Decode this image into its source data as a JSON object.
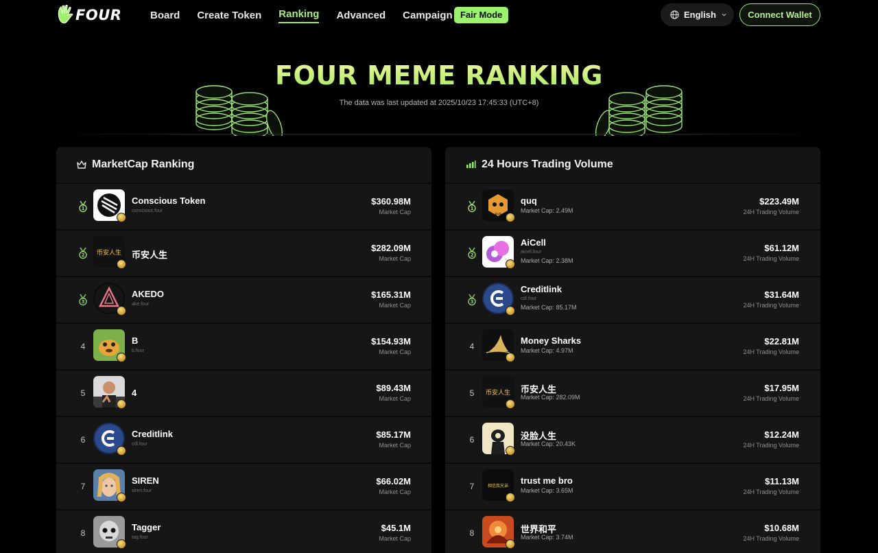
{
  "header": {
    "logo_text": "FOUR",
    "nav": [
      {
        "label": "Board",
        "active": false
      },
      {
        "label": "Create Token",
        "active": false
      },
      {
        "label": "Ranking",
        "active": true
      },
      {
        "label": "Advanced",
        "active": false
      },
      {
        "label": "Campaign",
        "active": false
      }
    ],
    "fair_mode_label": "Fair Mode",
    "language": "English",
    "connect_wallet": "Connect Wallet"
  },
  "hero": {
    "title": "FOUR MEME RANKING",
    "subtitle": "The data was last updated at 2025/10/23 17:45:33 (UTC+8)"
  },
  "marketcap_panel": {
    "title": "MarketCap Ranking",
    "icon": "crown-icon",
    "rows": [
      {
        "rank": "1",
        "medal": true,
        "name": "Conscious Token",
        "handle": "conscious.four",
        "value": "$360.98M",
        "value_label": "Market Cap",
        "avatar": "conscious"
      },
      {
        "rank": "2",
        "medal": true,
        "name": "币安人生",
        "handle": "",
        "value": "$282.09M",
        "value_label": "Market Cap",
        "avatar": "binance-life"
      },
      {
        "rank": "3",
        "medal": true,
        "name": "AKEDO",
        "handle": "ake.four",
        "value": "$165.31M",
        "value_label": "Market Cap",
        "avatar": "akedo"
      },
      {
        "rank": "4",
        "medal": false,
        "name": "B",
        "handle": "b.four",
        "value": "$154.93M",
        "value_label": "Market Cap",
        "avatar": "b"
      },
      {
        "rank": "5",
        "medal": false,
        "name": "4",
        "handle": "",
        "value": "$89.43M",
        "value_label": "Market Cap",
        "avatar": "four"
      },
      {
        "rank": "6",
        "medal": false,
        "name": "Creditlink",
        "handle": "cdl.four",
        "value": "$85.17M",
        "value_label": "Market Cap",
        "avatar": "creditlink"
      },
      {
        "rank": "7",
        "medal": false,
        "name": "SIREN",
        "handle": "siren.four",
        "value": "$66.02M",
        "value_label": "Market Cap",
        "avatar": "siren"
      },
      {
        "rank": "8",
        "medal": false,
        "name": "Tagger",
        "handle": "tag.four",
        "value": "$45.1M",
        "value_label": "Market Cap",
        "avatar": "tagger"
      }
    ]
  },
  "volume_panel": {
    "title": "24 Hours Trading Volume",
    "icon": "bar-chart-icon",
    "rows": [
      {
        "rank": "1",
        "medal": true,
        "name": "quq",
        "handle": "",
        "mcap": "Market Cap: 2.49M",
        "value": "$223.49M",
        "value_label": "24H Trading Volume",
        "avatar": "quq"
      },
      {
        "rank": "2",
        "medal": true,
        "name": "AiCell",
        "handle": "aicell.four",
        "mcap": "Market Cap: 2.38M",
        "value": "$61.12M",
        "value_label": "24H Trading Volume",
        "avatar": "aicell"
      },
      {
        "rank": "3",
        "medal": true,
        "name": "Creditlink",
        "handle": "cdl.four",
        "mcap": "Market Cap: 85.17M",
        "value": "$31.64M",
        "value_label": "24H Trading Volume",
        "avatar": "creditlink"
      },
      {
        "rank": "4",
        "medal": false,
        "name": "Money Sharks",
        "handle": "",
        "mcap": "Market Cap: 4.97M",
        "value": "$22.81M",
        "value_label": "24H Trading Volume",
        "avatar": "sharks"
      },
      {
        "rank": "5",
        "medal": false,
        "name": "币安人生",
        "handle": "",
        "mcap": "Market Cap: 282.09M",
        "value": "$17.95M",
        "value_label": "24H Trading Volume",
        "avatar": "binance-life"
      },
      {
        "rank": "6",
        "medal": false,
        "name": "没脸人生",
        "handle": "",
        "mcap": "Market Cap: 20.43K",
        "value": "$12.24M",
        "value_label": "24H Trading Volume",
        "avatar": "noface"
      },
      {
        "rank": "7",
        "medal": false,
        "name": "trust me bro",
        "handle": "",
        "mcap": "Market Cap: 3.65M",
        "value": "$11.13M",
        "value_label": "24H Trading Volume",
        "avatar": "trust"
      },
      {
        "rank": "8",
        "medal": false,
        "name": "世界和平",
        "handle": "",
        "mcap": "Market Cap: 3.74M",
        "value": "$10.68M",
        "value_label": "24H Trading Volume",
        "avatar": "peace"
      }
    ]
  },
  "colors": {
    "accent_green": "#a9ec7e",
    "fair_badge": "#9af26f",
    "panel_bg": "#141414",
    "page_bg": "#000000"
  }
}
